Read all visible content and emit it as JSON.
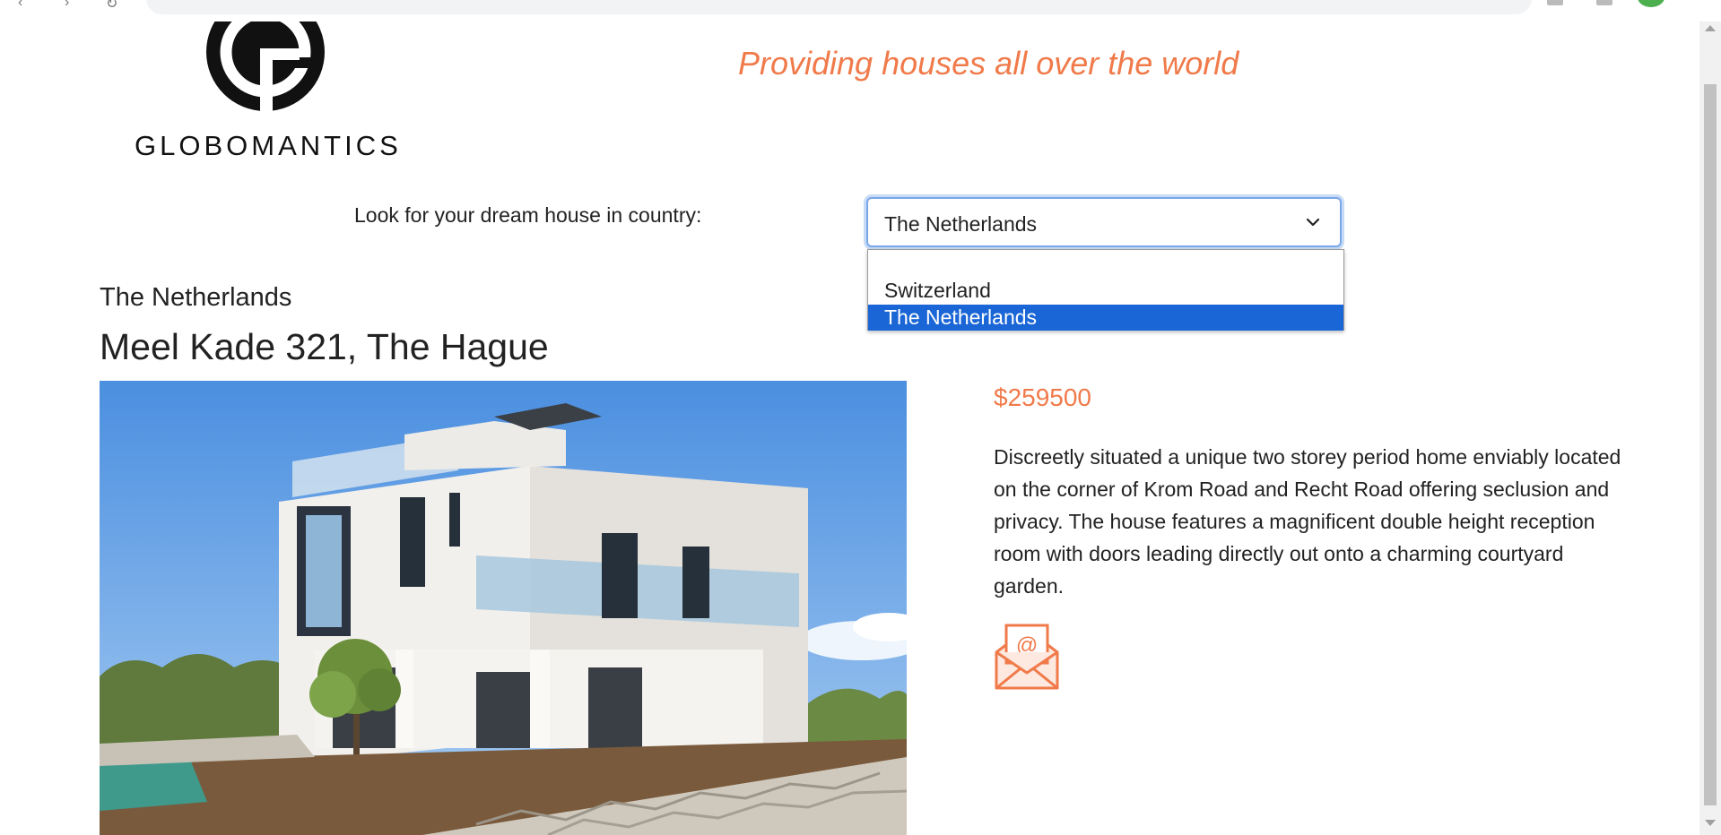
{
  "header": {
    "brand": "GLOBOMANTICS",
    "tagline": "Providing houses all over the world"
  },
  "search": {
    "label": "Look for your dream house in country:",
    "selected": "The Netherlands",
    "options": [
      "",
      "Switzerland",
      "The Netherlands"
    ]
  },
  "house": {
    "country": "The Netherlands",
    "address": "Meel Kade 321, The Hague",
    "price": "$259500",
    "description": "Discreetly situated a unique two storey period home enviably located on the corner of Krom Road and Recht Road offering seclusion and privacy. The house features a magnificent double height reception room with doors leading directly out onto a charming courtyard garden."
  },
  "icons": {
    "logo": "globomantics-g-logo",
    "contact": "email-envelope-icon",
    "select_indicator": "chevron-down-icon"
  },
  "colors": {
    "accent": "#f07a4a",
    "selected_option": "#1a66d6",
    "focus_border": "#7aa7e8"
  }
}
